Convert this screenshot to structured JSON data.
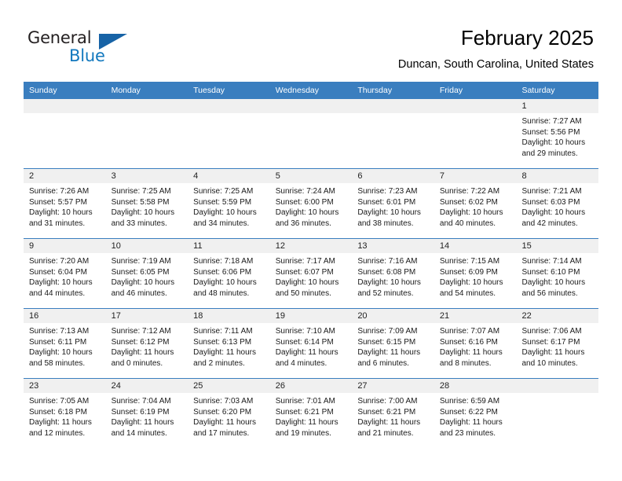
{
  "brand": {
    "name_part1": "General",
    "name_part2": "Blue",
    "accent_color": "#1763a6",
    "blue_text_color": "#1278be"
  },
  "header": {
    "title": "February 2025",
    "subtitle": "Duncan, South Carolina, United States"
  },
  "theme": {
    "header_row_bg": "#3a7ebf",
    "day_number_bg": "#f0f0f0",
    "cell_bg": "#ffffff"
  },
  "weekdays": [
    "Sunday",
    "Monday",
    "Tuesday",
    "Wednesday",
    "Thursday",
    "Friday",
    "Saturday"
  ],
  "weeks": [
    [
      {
        "day": "",
        "sunrise": "",
        "sunset": "",
        "daylight": "",
        "empty": true
      },
      {
        "day": "",
        "sunrise": "",
        "sunset": "",
        "daylight": "",
        "empty": true
      },
      {
        "day": "",
        "sunrise": "",
        "sunset": "",
        "daylight": "",
        "empty": true
      },
      {
        "day": "",
        "sunrise": "",
        "sunset": "",
        "daylight": "",
        "empty": true
      },
      {
        "day": "",
        "sunrise": "",
        "sunset": "",
        "daylight": "",
        "empty": true
      },
      {
        "day": "",
        "sunrise": "",
        "sunset": "",
        "daylight": "",
        "empty": true
      },
      {
        "day": "1",
        "sunrise": "Sunrise: 7:27 AM",
        "sunset": "Sunset: 5:56 PM",
        "daylight": "Daylight: 10 hours and 29 minutes.",
        "empty": false
      }
    ],
    [
      {
        "day": "2",
        "sunrise": "Sunrise: 7:26 AM",
        "sunset": "Sunset: 5:57 PM",
        "daylight": "Daylight: 10 hours and 31 minutes.",
        "empty": false
      },
      {
        "day": "3",
        "sunrise": "Sunrise: 7:25 AM",
        "sunset": "Sunset: 5:58 PM",
        "daylight": "Daylight: 10 hours and 33 minutes.",
        "empty": false
      },
      {
        "day": "4",
        "sunrise": "Sunrise: 7:25 AM",
        "sunset": "Sunset: 5:59 PM",
        "daylight": "Daylight: 10 hours and 34 minutes.",
        "empty": false
      },
      {
        "day": "5",
        "sunrise": "Sunrise: 7:24 AM",
        "sunset": "Sunset: 6:00 PM",
        "daylight": "Daylight: 10 hours and 36 minutes.",
        "empty": false
      },
      {
        "day": "6",
        "sunrise": "Sunrise: 7:23 AM",
        "sunset": "Sunset: 6:01 PM",
        "daylight": "Daylight: 10 hours and 38 minutes.",
        "empty": false
      },
      {
        "day": "7",
        "sunrise": "Sunrise: 7:22 AM",
        "sunset": "Sunset: 6:02 PM",
        "daylight": "Daylight: 10 hours and 40 minutes.",
        "empty": false
      },
      {
        "day": "8",
        "sunrise": "Sunrise: 7:21 AM",
        "sunset": "Sunset: 6:03 PM",
        "daylight": "Daylight: 10 hours and 42 minutes.",
        "empty": false
      }
    ],
    [
      {
        "day": "9",
        "sunrise": "Sunrise: 7:20 AM",
        "sunset": "Sunset: 6:04 PM",
        "daylight": "Daylight: 10 hours and 44 minutes.",
        "empty": false
      },
      {
        "day": "10",
        "sunrise": "Sunrise: 7:19 AM",
        "sunset": "Sunset: 6:05 PM",
        "daylight": "Daylight: 10 hours and 46 minutes.",
        "empty": false
      },
      {
        "day": "11",
        "sunrise": "Sunrise: 7:18 AM",
        "sunset": "Sunset: 6:06 PM",
        "daylight": "Daylight: 10 hours and 48 minutes.",
        "empty": false
      },
      {
        "day": "12",
        "sunrise": "Sunrise: 7:17 AM",
        "sunset": "Sunset: 6:07 PM",
        "daylight": "Daylight: 10 hours and 50 minutes.",
        "empty": false
      },
      {
        "day": "13",
        "sunrise": "Sunrise: 7:16 AM",
        "sunset": "Sunset: 6:08 PM",
        "daylight": "Daylight: 10 hours and 52 minutes.",
        "empty": false
      },
      {
        "day": "14",
        "sunrise": "Sunrise: 7:15 AM",
        "sunset": "Sunset: 6:09 PM",
        "daylight": "Daylight: 10 hours and 54 minutes.",
        "empty": false
      },
      {
        "day": "15",
        "sunrise": "Sunrise: 7:14 AM",
        "sunset": "Sunset: 6:10 PM",
        "daylight": "Daylight: 10 hours and 56 minutes.",
        "empty": false
      }
    ],
    [
      {
        "day": "16",
        "sunrise": "Sunrise: 7:13 AM",
        "sunset": "Sunset: 6:11 PM",
        "daylight": "Daylight: 10 hours and 58 minutes.",
        "empty": false
      },
      {
        "day": "17",
        "sunrise": "Sunrise: 7:12 AM",
        "sunset": "Sunset: 6:12 PM",
        "daylight": "Daylight: 11 hours and 0 minutes.",
        "empty": false
      },
      {
        "day": "18",
        "sunrise": "Sunrise: 7:11 AM",
        "sunset": "Sunset: 6:13 PM",
        "daylight": "Daylight: 11 hours and 2 minutes.",
        "empty": false
      },
      {
        "day": "19",
        "sunrise": "Sunrise: 7:10 AM",
        "sunset": "Sunset: 6:14 PM",
        "daylight": "Daylight: 11 hours and 4 minutes.",
        "empty": false
      },
      {
        "day": "20",
        "sunrise": "Sunrise: 7:09 AM",
        "sunset": "Sunset: 6:15 PM",
        "daylight": "Daylight: 11 hours and 6 minutes.",
        "empty": false
      },
      {
        "day": "21",
        "sunrise": "Sunrise: 7:07 AM",
        "sunset": "Sunset: 6:16 PM",
        "daylight": "Daylight: 11 hours and 8 minutes.",
        "empty": false
      },
      {
        "day": "22",
        "sunrise": "Sunrise: 7:06 AM",
        "sunset": "Sunset: 6:17 PM",
        "daylight": "Daylight: 11 hours and 10 minutes.",
        "empty": false
      }
    ],
    [
      {
        "day": "23",
        "sunrise": "Sunrise: 7:05 AM",
        "sunset": "Sunset: 6:18 PM",
        "daylight": "Daylight: 11 hours and 12 minutes.",
        "empty": false
      },
      {
        "day": "24",
        "sunrise": "Sunrise: 7:04 AM",
        "sunset": "Sunset: 6:19 PM",
        "daylight": "Daylight: 11 hours and 14 minutes.",
        "empty": false
      },
      {
        "day": "25",
        "sunrise": "Sunrise: 7:03 AM",
        "sunset": "Sunset: 6:20 PM",
        "daylight": "Daylight: 11 hours and 17 minutes.",
        "empty": false
      },
      {
        "day": "26",
        "sunrise": "Sunrise: 7:01 AM",
        "sunset": "Sunset: 6:21 PM",
        "daylight": "Daylight: 11 hours and 19 minutes.",
        "empty": false
      },
      {
        "day": "27",
        "sunrise": "Sunrise: 7:00 AM",
        "sunset": "Sunset: 6:21 PM",
        "daylight": "Daylight: 11 hours and 21 minutes.",
        "empty": false
      },
      {
        "day": "28",
        "sunrise": "Sunrise: 6:59 AM",
        "sunset": "Sunset: 6:22 PM",
        "daylight": "Daylight: 11 hours and 23 minutes.",
        "empty": false
      },
      {
        "day": "",
        "sunrise": "",
        "sunset": "",
        "daylight": "",
        "empty": true
      }
    ]
  ]
}
